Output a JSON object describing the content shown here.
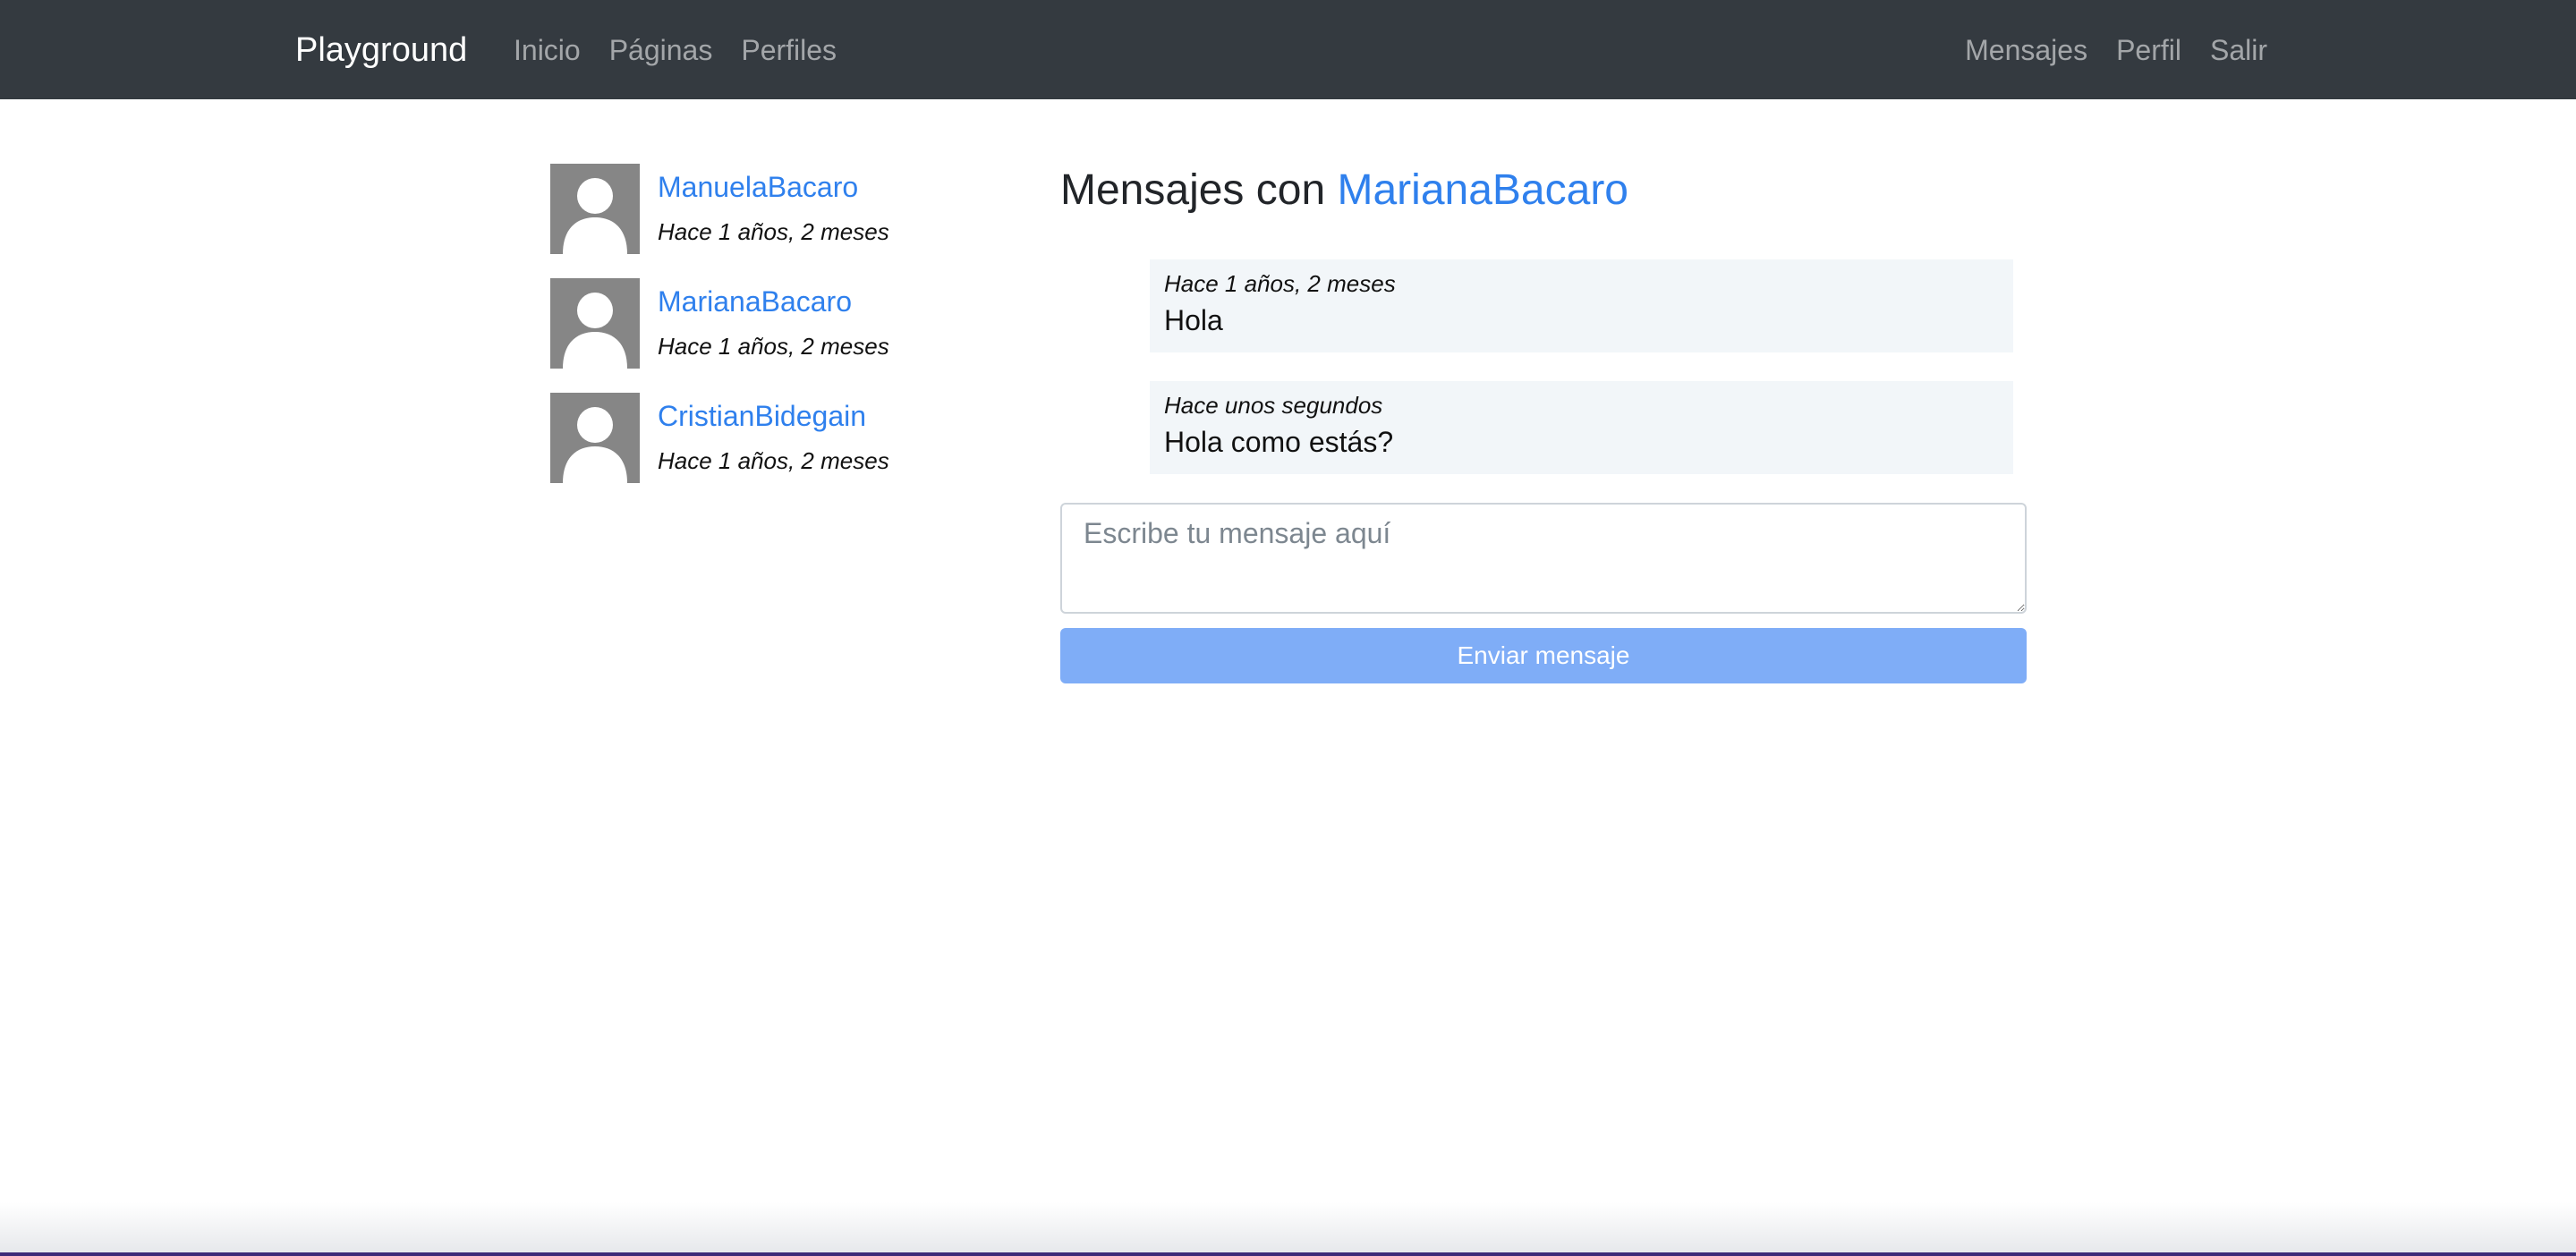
{
  "navbar": {
    "brand": "Playground",
    "left_links": [
      "Inicio",
      "Páginas",
      "Perfiles"
    ],
    "right_links": [
      "Mensajes",
      "Perfil",
      "Salir"
    ]
  },
  "threads": [
    {
      "name": "ManuelaBacaro",
      "time": "Hace 1 años, 2 meses"
    },
    {
      "name": "MarianaBacaro",
      "time": "Hace 1 años, 2 meses"
    },
    {
      "name": "CristianBidegain",
      "time": "Hace 1 años, 2 meses"
    }
  ],
  "conversation": {
    "title_prefix": "Mensajes con",
    "partner": "MarianaBacaro",
    "messages": [
      {
        "time": "Hace 1 años, 2 meses",
        "text": "Hola"
      },
      {
        "time": "Hace unos segundos",
        "text": "Hola como estás?"
      }
    ],
    "input_placeholder": "Escribe tu mensaje aquí",
    "send_label": "Enviar mensaje"
  },
  "colors": {
    "navbar_bg": "#343a40",
    "link_blue": "#2f80ed",
    "send_button": "#7fadf7",
    "message_bg": "#f2f6f9",
    "avatar_bg": "#868686"
  }
}
